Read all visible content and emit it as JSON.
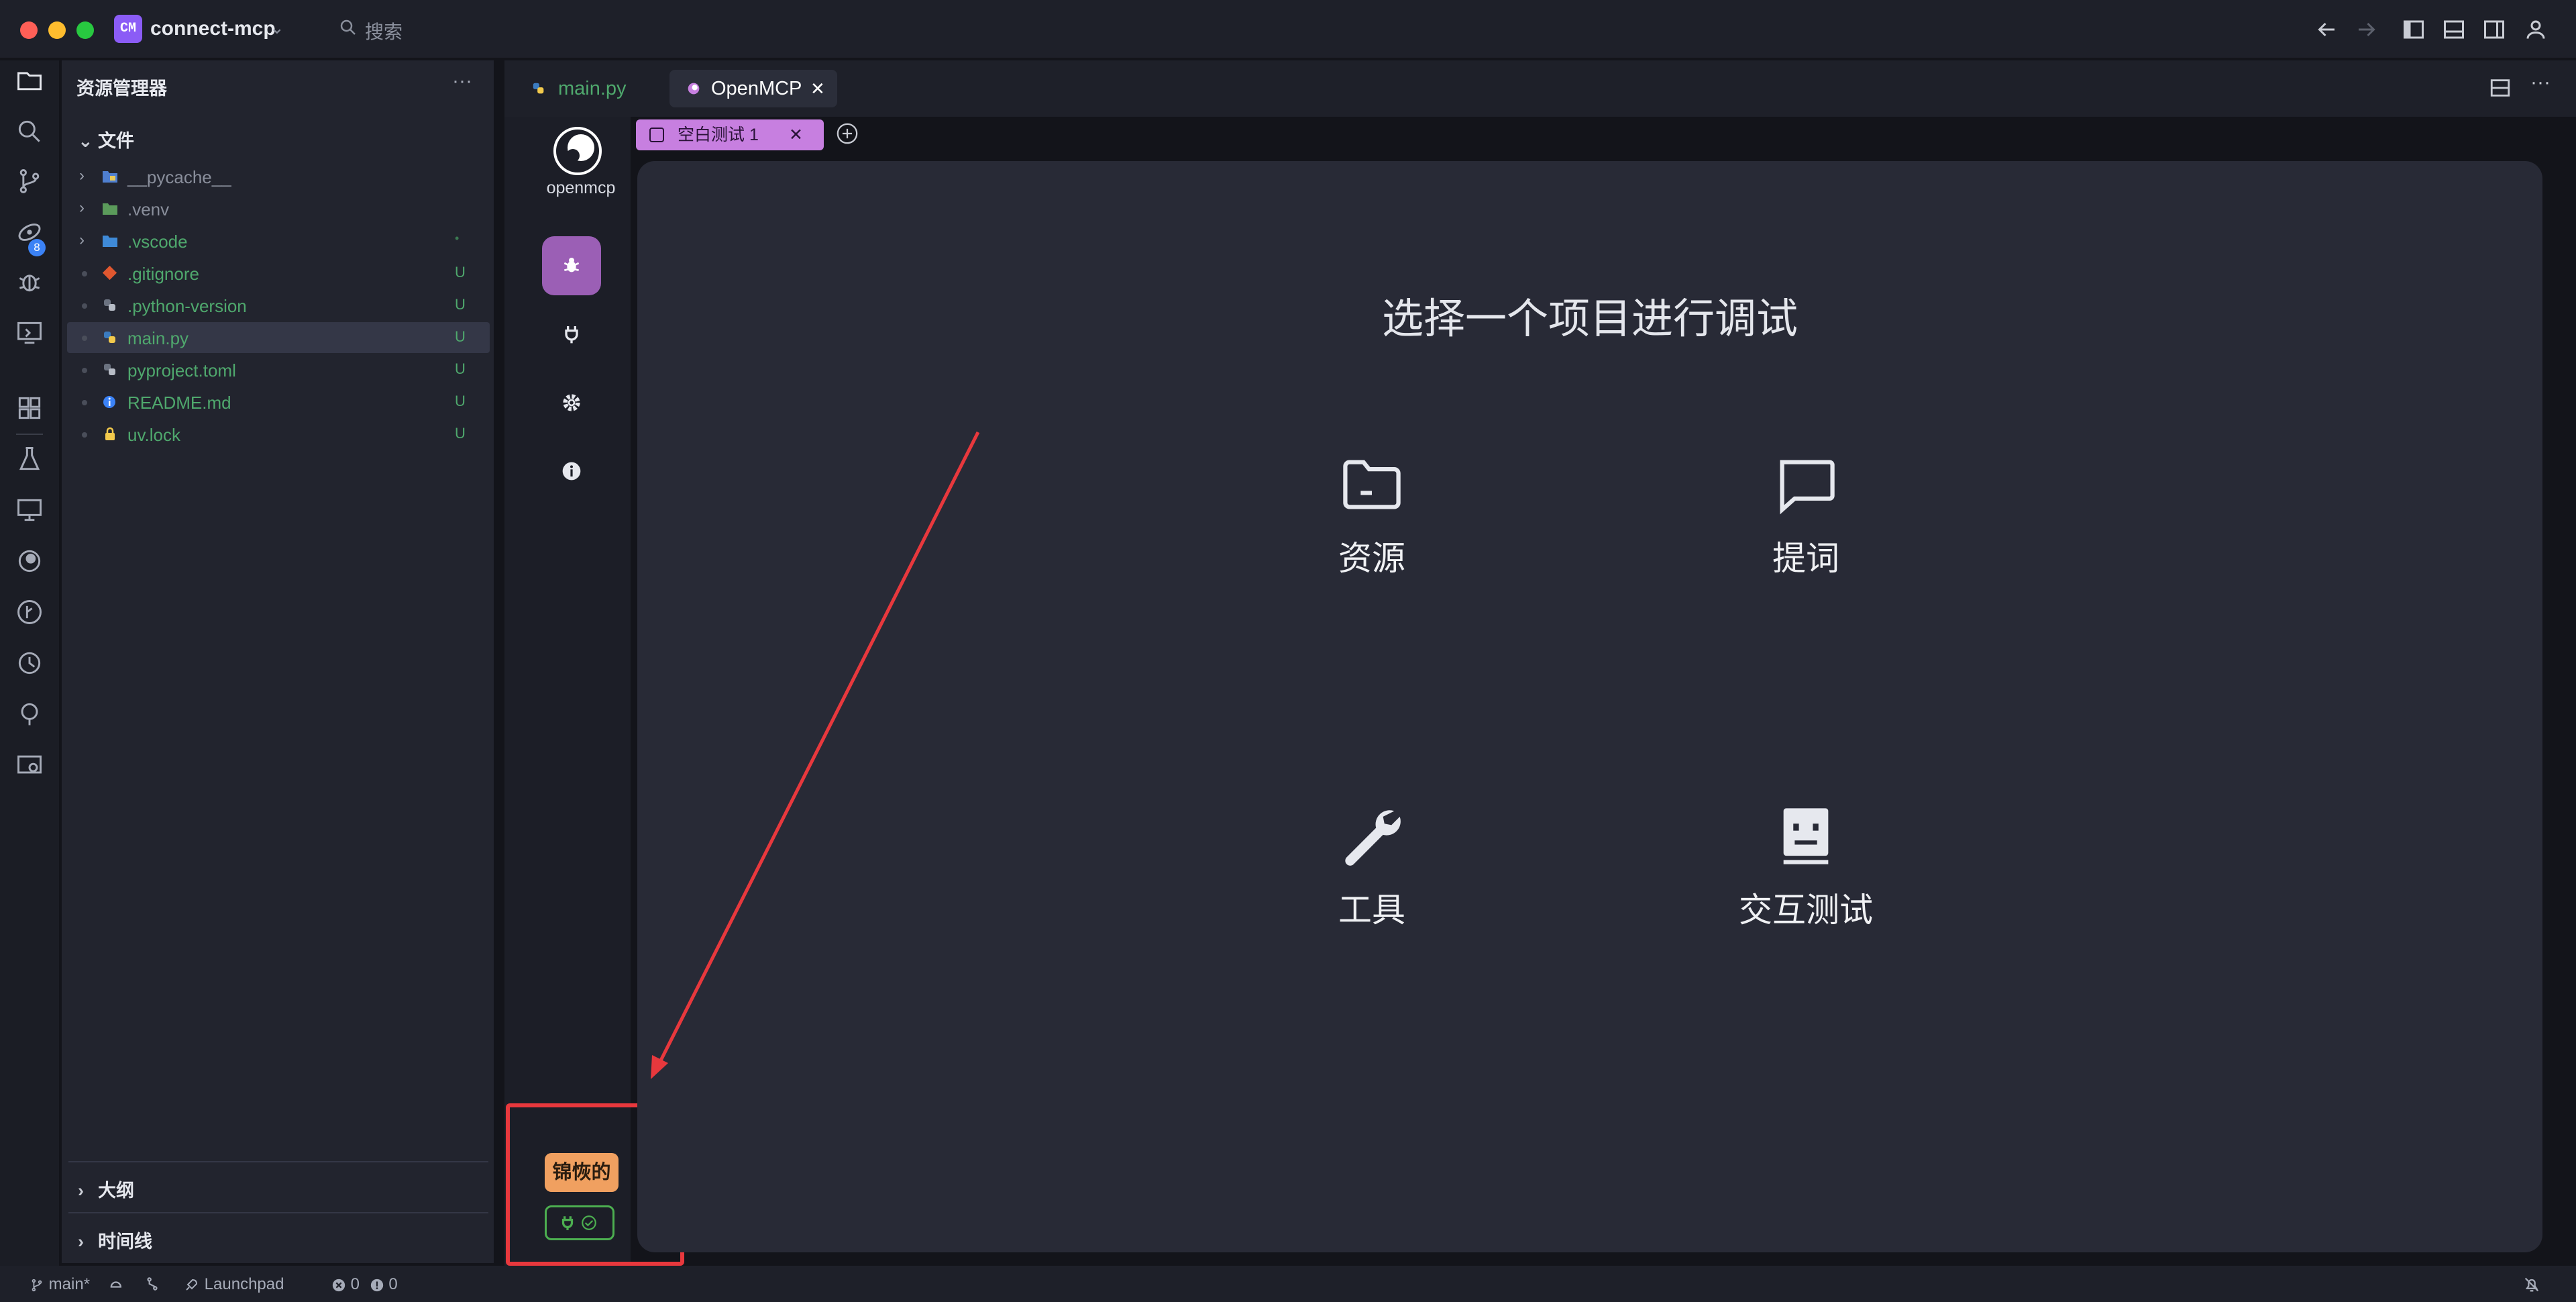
{
  "titlebar": {
    "project_badge": "CM",
    "project_name": "connect-mcp",
    "search_placeholder": "搜索"
  },
  "activity_bar": {
    "source_control_count": "8"
  },
  "explorer": {
    "title": "资源管理器",
    "files_section": "文件",
    "items": [
      {
        "name": "__pycache__",
        "type": "folder",
        "status": ""
      },
      {
        "name": ".venv",
        "type": "folder",
        "status": ""
      },
      {
        "name": ".vscode",
        "type": "folder",
        "status": "•"
      },
      {
        "name": ".gitignore",
        "type": "git",
        "status": "U"
      },
      {
        "name": ".python-version",
        "type": "python",
        "status": "U"
      },
      {
        "name": "main.py",
        "type": "python",
        "status": "U"
      },
      {
        "name": "pyproject.toml",
        "type": "toml",
        "status": "U"
      },
      {
        "name": "README.md",
        "type": "info",
        "status": "U"
      },
      {
        "name": "uv.lock",
        "type": "lock",
        "status": "U"
      }
    ],
    "outline_section": "大纲",
    "timeline_section": "时间线"
  },
  "tabs": {
    "main_py": "main.py",
    "openmcp": "OpenMCP"
  },
  "openmcp": {
    "logo_label": "openmcp",
    "inner_tab_label": "空白测试 1",
    "title": "选择一个项目进行调试",
    "choices": {
      "resources": "资源",
      "prompts": "提词",
      "tools": "工具",
      "interactive": "交互测试"
    },
    "user_badge": "锦恢的"
  },
  "statusbar": {
    "branch": "main*",
    "launchpad": "Launchpad",
    "errors": "0",
    "warnings": "0"
  },
  "colors": {
    "accent_purple": "#9b5fb5",
    "tab_pink": "#c77fe0",
    "user_badge": "#f0a060",
    "connected_green": "#4caf50",
    "annotation_red": "#e8383d",
    "untracked_green": "#4fa86d"
  }
}
